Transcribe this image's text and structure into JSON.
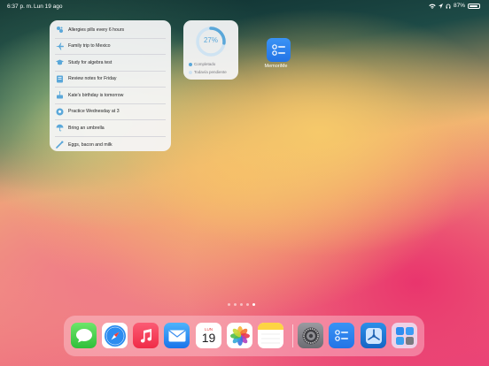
{
  "status_bar": {
    "time": "6:37 p. m.",
    "date": "Lun 19 ago",
    "battery": "87%",
    "battery_level": 0.87
  },
  "reminders_widget": {
    "items": [
      {
        "label": "Allergies pills every 6 hours",
        "icon": "pills-icon"
      },
      {
        "label": "Family trip to Mexico",
        "icon": "airplane-icon"
      },
      {
        "label": "Study for algebra test",
        "icon": "graduation-cap-icon"
      },
      {
        "label": "Review notes for Friday",
        "icon": "notebook-icon"
      },
      {
        "label": "Kate's birthday is tomorrow",
        "icon": "cake-icon"
      },
      {
        "label": "Practice Wednesday at 3",
        "icon": "soccer-ball-icon"
      },
      {
        "label": "Bring an umbrella",
        "icon": "umbrella-icon"
      },
      {
        "label": "Eggs, bacon and milk",
        "icon": "shopping-icon"
      }
    ]
  },
  "progress_widget": {
    "percent_label": "27%",
    "percent": 27,
    "legend_completed": "Completado",
    "legend_pending": "Todavía pendiente",
    "colors": {
      "completed": "#5aa7d9",
      "pending": "#cfe3f2"
    }
  },
  "home_app": {
    "label": "MemoriMe",
    "icon": "checklist-icon"
  },
  "page_indicator": {
    "count": 5,
    "active_index": 4
  },
  "calendar_icon": {
    "day": "LUN",
    "number": "19"
  },
  "dock_apps": [
    {
      "name": "Messages",
      "icon": "messages-icon"
    },
    {
      "name": "Safari",
      "icon": "safari-icon"
    },
    {
      "name": "Music",
      "icon": "music-icon"
    },
    {
      "name": "Mail",
      "icon": "mail-icon"
    },
    {
      "name": "Calendar",
      "icon": "calendar-icon"
    },
    {
      "name": "Photos",
      "icon": "photos-icon"
    },
    {
      "name": "Notes",
      "icon": "notes-icon"
    },
    {
      "name": "Settings",
      "icon": "settings-icon"
    },
    {
      "name": "MemoriMe",
      "icon": "checklist-icon"
    },
    {
      "name": "Xcode",
      "icon": "xcode-icon"
    },
    {
      "name": "App Library",
      "icon": "app-library-icon"
    }
  ]
}
